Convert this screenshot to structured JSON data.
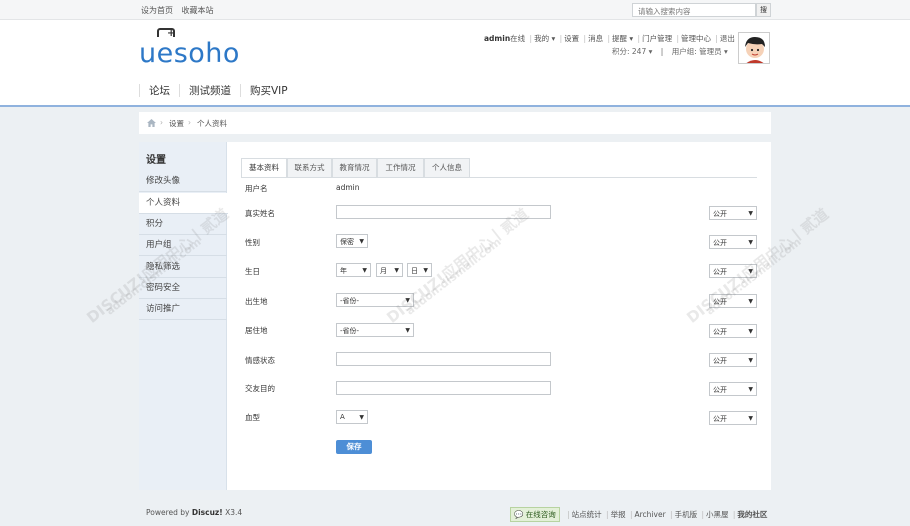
{
  "topbar": {
    "set_home": "设为首页",
    "bookmark": "收藏本站",
    "search_placeholder": "请输入搜索内容",
    "search_button": "搜"
  },
  "logo": {
    "text": "uesoho"
  },
  "user": {
    "name": "admin",
    "online": "在线",
    "nav": [
      "我的",
      "设置",
      "消息",
      "提醒",
      "门户管理",
      "管理中心",
      "退出"
    ],
    "points_label": "积分: 247",
    "group_label": "用户组: 管理员"
  },
  "nav": [
    "论坛",
    "测试频道",
    "购买VIP"
  ],
  "breadcrumb": [
    "设置",
    "个人资料"
  ],
  "sidebar": {
    "title": "设置",
    "items": [
      "修改头像",
      "个人资料",
      "积分",
      "用户组",
      "隐私筛选",
      "密码安全",
      "访问推广"
    ]
  },
  "tabs": [
    "基本资料",
    "联系方式",
    "教育情况",
    "工作情况",
    "个人信息"
  ],
  "form": {
    "username_label": "用户名",
    "username_value": "admin",
    "realname_label": "真实姓名",
    "gender_label": "性别",
    "gender_value": "保密",
    "birthday_label": "生日",
    "year_value": "年",
    "month_value": "月",
    "day_value": "日",
    "birthplace_label": "出生地",
    "province_value": "-省份-",
    "residence_label": "居住地",
    "relationship_label": "情感状态",
    "lookingfor_label": "交友目的",
    "bloodtype_label": "血型",
    "bloodtype_value": "A",
    "privacy_value": "公开",
    "save_label": "保存"
  },
  "watermark": {
    "line1": "DISCUZ!应用中心丨贰道",
    "line2": "addon.dismall.com"
  },
  "footer": {
    "powered_prefix": "Powered by ",
    "powered_brand": "Discuz!",
    "powered_version": " X3.4",
    "chat": "在线咨询",
    "links": [
      "站点统计",
      "举报",
      "Archiver",
      "手机版",
      "小黑屋"
    ],
    "community": "我的社区"
  }
}
